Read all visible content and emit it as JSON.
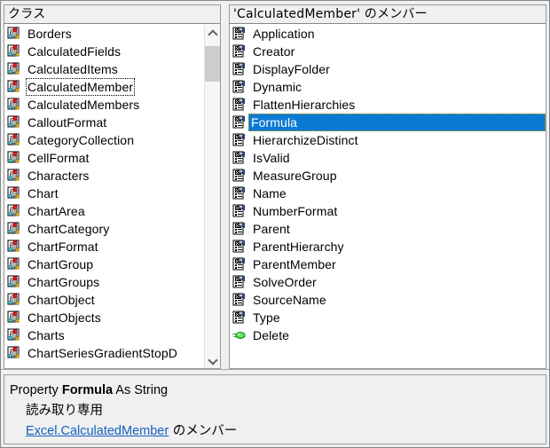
{
  "colors": {
    "selection": "#0a7ad4",
    "link": "#1560bd",
    "window_bg": "#f0f0f0",
    "list_bg": "#ffffff",
    "border": "#9a9a9a",
    "scroll_thumb": "#cdcdcd"
  },
  "classes_pane": {
    "header": "クラス",
    "icon": "class-icon",
    "scrollbar": {
      "up_icon": "chevron-up-icon",
      "down_icon": "chevron-down-icon",
      "thumb": "scroll-thumb"
    },
    "items": [
      {
        "label": "Borders",
        "state": "normal"
      },
      {
        "label": "CalculatedFields",
        "state": "normal"
      },
      {
        "label": "CalculatedItems",
        "state": "normal"
      },
      {
        "label": "CalculatedMember",
        "state": "focused"
      },
      {
        "label": "CalculatedMembers",
        "state": "normal"
      },
      {
        "label": "CalloutFormat",
        "state": "normal"
      },
      {
        "label": "CategoryCollection",
        "state": "normal"
      },
      {
        "label": "CellFormat",
        "state": "normal"
      },
      {
        "label": "Characters",
        "state": "normal"
      },
      {
        "label": "Chart",
        "state": "normal"
      },
      {
        "label": "ChartArea",
        "state": "normal"
      },
      {
        "label": "ChartCategory",
        "state": "normal"
      },
      {
        "label": "ChartFormat",
        "state": "normal"
      },
      {
        "label": "ChartGroup",
        "state": "normal"
      },
      {
        "label": "ChartGroups",
        "state": "normal"
      },
      {
        "label": "ChartObject",
        "state": "normal"
      },
      {
        "label": "ChartObjects",
        "state": "normal"
      },
      {
        "label": "Charts",
        "state": "normal"
      },
      {
        "label": "ChartSeriesGradientStopD",
        "state": "normal"
      }
    ]
  },
  "members_pane": {
    "header": "'CalculatedMember' のメンバー",
    "items": [
      {
        "label": "Application",
        "icon": "property-icon",
        "state": "normal"
      },
      {
        "label": "Creator",
        "icon": "property-icon",
        "state": "normal"
      },
      {
        "label": "DisplayFolder",
        "icon": "property-icon",
        "state": "normal"
      },
      {
        "label": "Dynamic",
        "icon": "property-icon",
        "state": "normal"
      },
      {
        "label": "FlattenHierarchies",
        "icon": "property-icon",
        "state": "normal"
      },
      {
        "label": "Formula",
        "icon": "property-icon",
        "state": "selected"
      },
      {
        "label": "HierarchizeDistinct",
        "icon": "property-icon",
        "state": "normal"
      },
      {
        "label": "IsValid",
        "icon": "property-icon",
        "state": "normal"
      },
      {
        "label": "MeasureGroup",
        "icon": "property-icon",
        "state": "normal"
      },
      {
        "label": "Name",
        "icon": "property-icon",
        "state": "normal"
      },
      {
        "label": "NumberFormat",
        "icon": "property-icon",
        "state": "normal"
      },
      {
        "label": "Parent",
        "icon": "property-icon",
        "state": "normal"
      },
      {
        "label": "ParentHierarchy",
        "icon": "property-icon",
        "state": "normal"
      },
      {
        "label": "ParentMember",
        "icon": "property-icon",
        "state": "normal"
      },
      {
        "label": "SolveOrder",
        "icon": "property-icon",
        "state": "normal"
      },
      {
        "label": "SourceName",
        "icon": "property-icon",
        "state": "normal"
      },
      {
        "label": "Type",
        "icon": "property-icon",
        "state": "normal"
      },
      {
        "label": "Delete",
        "icon": "method-icon",
        "state": "normal"
      }
    ]
  },
  "details_pane": {
    "signature_prefix": "Property",
    "signature_name": "Formula",
    "signature_suffix": "As String",
    "readonly_text": "読み取り専用",
    "member_of_link": "Excel.CalculatedMember",
    "member_of_suffix": " のメンバー"
  }
}
